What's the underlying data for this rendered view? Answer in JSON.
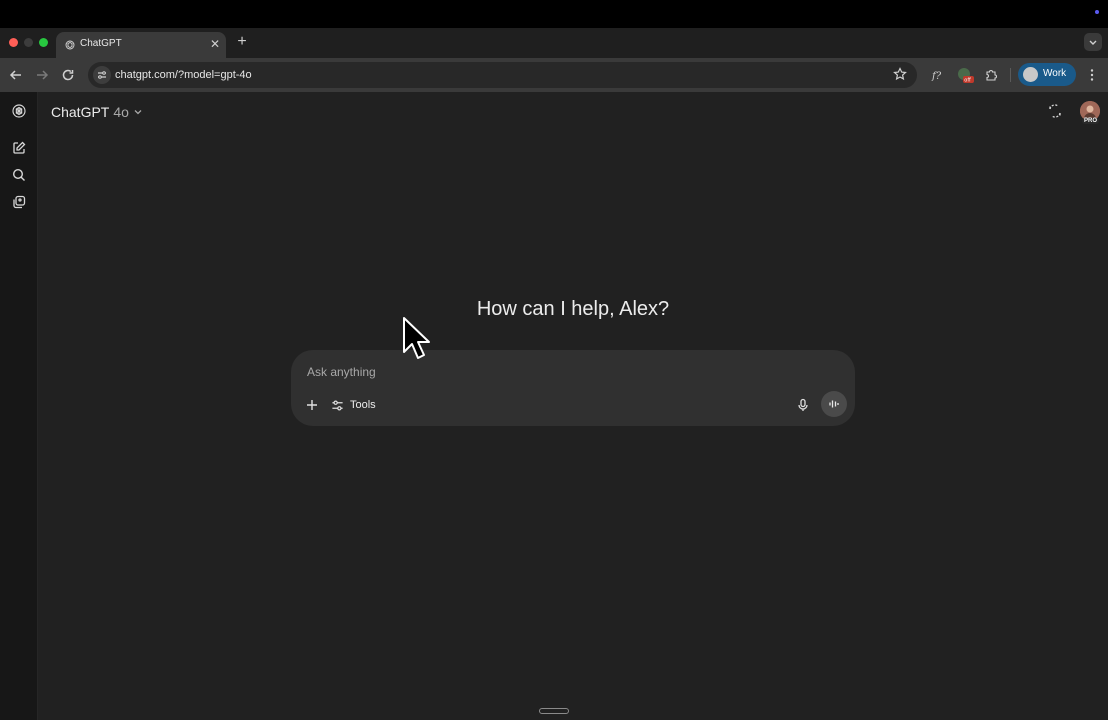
{
  "browser": {
    "tab_title": "ChatGPT",
    "url": "chatgpt.com/?model=gpt-4o",
    "profile_label": "Work"
  },
  "header": {
    "model_name": "ChatGPT",
    "model_version": "4o"
  },
  "main": {
    "greeting": "How can I help, Alex?",
    "composer": {
      "placeholder": "Ask anything",
      "tools_label": "Tools"
    }
  },
  "user": {
    "badge": "PRO"
  },
  "extension": {
    "badge": "off"
  },
  "colors": {
    "app_bg": "#212121",
    "sidebar_bg": "#171717",
    "composer_bg": "#303030",
    "profile_pill": "#1a5a8a"
  },
  "icons": [
    "chatgpt-logo-icon",
    "new-chat-icon",
    "search-icon",
    "library-icon",
    "temporary-chat-icon",
    "mic-icon",
    "voice-mode-icon",
    "plus-icon",
    "tools-icon",
    "star-icon",
    "extensions-icon",
    "back-icon",
    "forward-icon",
    "reload-icon",
    "site-info-icon",
    "more-icon"
  ]
}
